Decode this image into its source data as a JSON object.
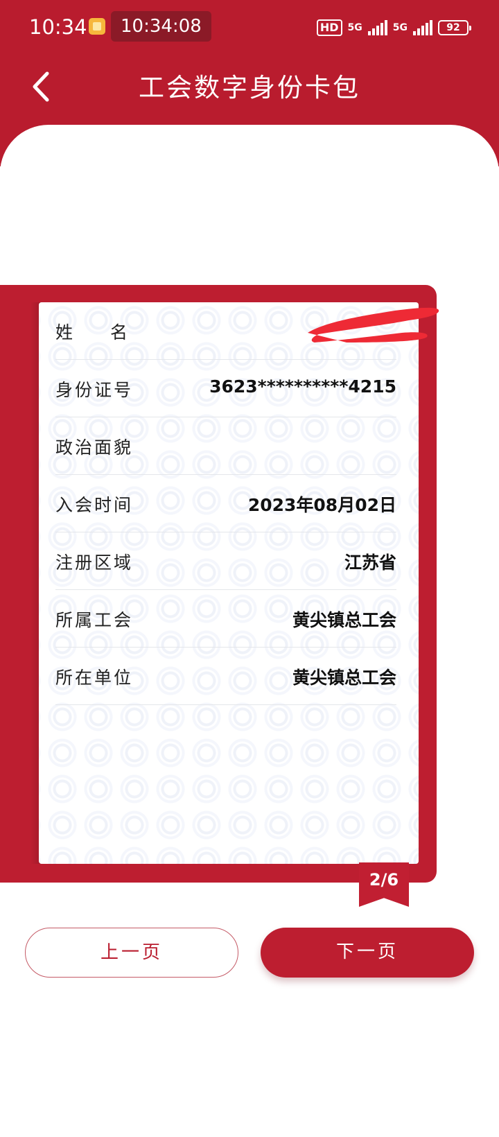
{
  "status_bar": {
    "time": "10:34",
    "clock_chip": "10:34:08",
    "hd_label": "HD",
    "network_1": "5G",
    "network_2": "5G",
    "battery": "92"
  },
  "header": {
    "title": "工会数字身份卡包",
    "back_icon": "chevron-left-icon"
  },
  "card": {
    "fields": [
      {
        "label": "姓名",
        "value": ""
      },
      {
        "label": "身份证号",
        "value": "3623**********4215"
      },
      {
        "label": "政治面貌",
        "value": ""
      },
      {
        "label": "入会时间",
        "value": "2023年08月02日"
      },
      {
        "label": "注册区域",
        "value": "江苏省"
      },
      {
        "label": "所属工会",
        "value": "黄尖镇总工会"
      },
      {
        "label": "所在单位",
        "value": "黄尖镇总工会"
      }
    ],
    "page_indicator": "2/6"
  },
  "buttons": {
    "prev_label": "上一页",
    "next_label": "下一页"
  },
  "colors": {
    "brand_red": "#b91c2e",
    "redaction": "#ee2a35"
  }
}
